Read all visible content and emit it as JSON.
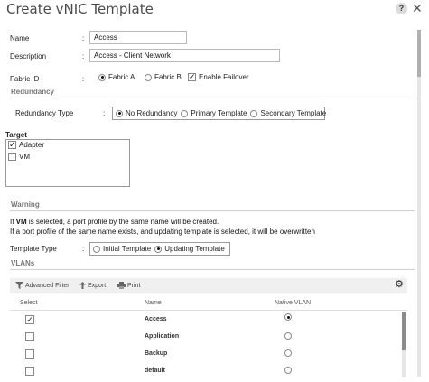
{
  "dialog": {
    "title": "Create vNIC Template",
    "help_glyph": "?",
    "close_glyph": "✕"
  },
  "form": {
    "name": {
      "label": "Name",
      "value": "Access"
    },
    "description": {
      "label": "Description",
      "value": "Access - Client Network"
    },
    "fabric_id": {
      "label": "Fabric ID",
      "options": [
        "Fabric A",
        "Fabric B"
      ],
      "selected": "Fabric A",
      "failover_label": "Enable Failover",
      "failover_checked": true
    },
    "colon": ":"
  },
  "redundancy": {
    "section": "Redundancy",
    "label": "Redundancy Type",
    "options": [
      "No Redundancy",
      "Primary Template",
      "Secondary Template"
    ],
    "selected": "No Redundancy"
  },
  "target": {
    "label": "Target",
    "items": [
      {
        "label": "Adapter",
        "checked": true
      },
      {
        "label": "VM",
        "checked": false
      }
    ]
  },
  "warning": {
    "section": "Warning",
    "line1_prefix": "If ",
    "line1_bold": "VM",
    "line1_suffix": " is selected, a port profile by the same name will be created.",
    "line2": "If a port profile of the same name exists, and updating template is selected, it will be overwritten"
  },
  "template_type": {
    "label": "Template Type",
    "options": [
      "Initial Template",
      "Updating Template"
    ],
    "selected": "Updating Template"
  },
  "vlans": {
    "section": "VLANs",
    "toolbar": {
      "filter": "Advanced Filter",
      "export": "Export",
      "print": "Print"
    },
    "columns": [
      "Select",
      "Name",
      "Native VLAN"
    ],
    "rows": [
      {
        "name": "Access",
        "selected": true,
        "native": true
      },
      {
        "name": "Application",
        "selected": false,
        "native": false
      },
      {
        "name": "Backup",
        "selected": false,
        "native": false
      },
      {
        "name": "default",
        "selected": false,
        "native": false
      }
    ]
  },
  "colors": {
    "border": "#9a9a9a",
    "section": "#777777",
    "toolbar": "#f0f0f0"
  }
}
